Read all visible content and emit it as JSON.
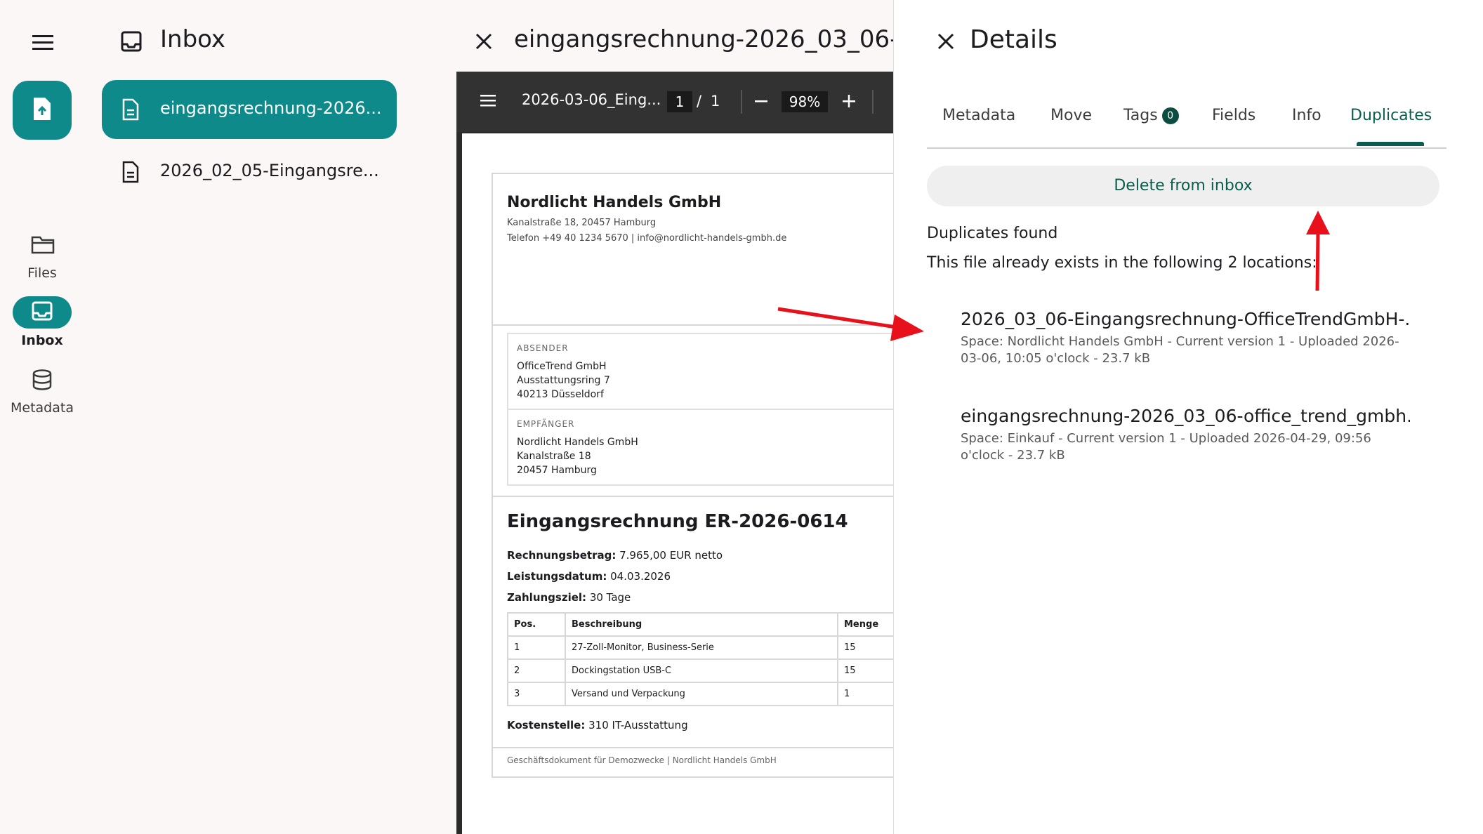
{
  "rail": {
    "items": [
      {
        "label": "Files"
      },
      {
        "label": "Inbox"
      },
      {
        "label": "Metadata"
      }
    ]
  },
  "inbox": {
    "title": "Inbox",
    "files": [
      {
        "name": "eingangsrechnung-2026..."
      },
      {
        "name": "2026_02_05-Eingangsre..."
      }
    ]
  },
  "viewer": {
    "title": "eingangsrechnung-2026_03_06-",
    "toolbar": {
      "file_name": "2026-03-06_Eing...",
      "page_current": "1",
      "page_separator": "/",
      "page_total": "1",
      "zoom": "98%"
    },
    "document": {
      "company": "Nordlicht Handels GmbH",
      "address_line": "Kanalstraße 18, 20457 Hamburg",
      "contact_line": "Telefon +49 40 1234 5670 | info@nordlicht-handels-gmbh.de",
      "sender_label": "ABSENDER",
      "sender": [
        "OfficeTrend GmbH",
        "Ausstattungsring 7",
        "40213 Düsseldorf"
      ],
      "recipient_label": "EMPFÄNGER",
      "recipient": [
        "Nordlicht Handels GmbH",
        "Kanalstraße 18",
        "20457 Hamburg"
      ],
      "invoice_title": "Eingangsrechnung ER-2026-0614",
      "amount_label": "Rechnungsbetrag:",
      "amount_value": "7.965,00 EUR netto",
      "date_label": "Leistungsdatum:",
      "date_value": "04.03.2026",
      "terms_label": "Zahlungsziel:",
      "terms_value": "30 Tage",
      "table_headers": [
        "Pos.",
        "Beschreibung",
        "Menge"
      ],
      "table_rows": [
        [
          "1",
          "27-Zoll-Monitor, Business-Serie",
          "15"
        ],
        [
          "2",
          "Dockingstation USB-C",
          "15"
        ],
        [
          "3",
          "Versand und Verpackung",
          "1"
        ]
      ],
      "cost_label": "Kostenstelle:",
      "cost_value": "310 IT-Ausstattung",
      "footer": "Geschäftsdokument für Demozwecke | Nordlicht Handels GmbH"
    }
  },
  "details": {
    "title": "Details",
    "tabs": [
      {
        "label": "Metadata"
      },
      {
        "label": "Move"
      },
      {
        "label": "Tags",
        "badge": "0"
      },
      {
        "label": "Fields"
      },
      {
        "label": "Info"
      },
      {
        "label": "Duplicates"
      }
    ],
    "delete_label": "Delete from inbox",
    "dup_heading": "Duplicates found",
    "dup_description": "This file already exists in the following 2 locations:",
    "entries": [
      {
        "title": "2026_03_06-Eingangsrechnung-OfficeTrendGmbH-...",
        "meta": "Space: Nordlicht Handels GmbH - Current version 1 - Uploaded 2026-03-06, 10:05 o'clock - 23.7 kB"
      },
      {
        "title": "eingangsrechnung-2026_03_06-office_trend_gmbh....",
        "meta": "Space: Einkauf - Current version 1 - Uploaded 2026-04-29, 09:56 o'clock - 23.7 kB"
      }
    ]
  },
  "colors": {
    "accent": "#0e8a8a",
    "tab_active": "#0b5d4d",
    "annotation_arrow": "#e8101b"
  }
}
